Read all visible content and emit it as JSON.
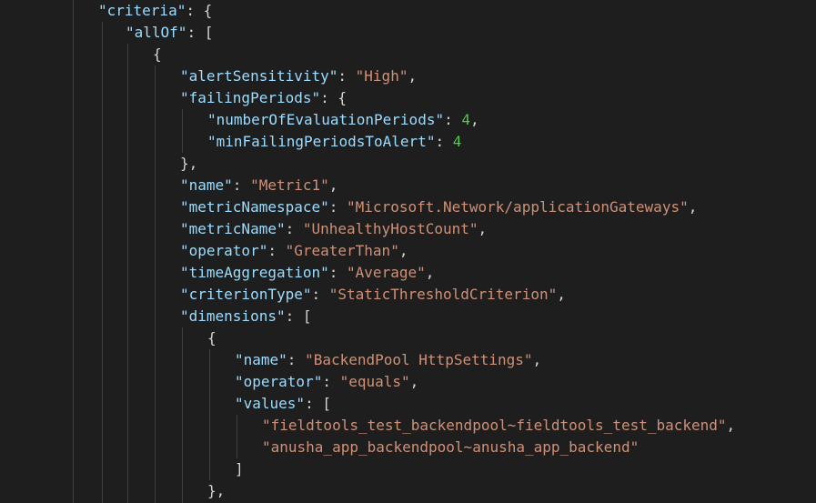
{
  "editor": {
    "colors": {
      "background": "#1e1e1e",
      "key": "#9cdcfe",
      "string": "#ce9178",
      "number": "#4ec94e",
      "punctuation": "#d4d4d4",
      "indent_guide": "#404040"
    },
    "lines": [
      {
        "indent": 0,
        "tokens": [
          {
            "t": "key",
            "v": "\"criteria\""
          },
          {
            "t": "pun",
            "v": ": {"
          }
        ]
      },
      {
        "indent": 1,
        "tokens": [
          {
            "t": "key",
            "v": "\"allOf\""
          },
          {
            "t": "pun",
            "v": ": ["
          }
        ]
      },
      {
        "indent": 2,
        "tokens": [
          {
            "t": "pun",
            "v": "{"
          }
        ]
      },
      {
        "indent": 3,
        "tokens": [
          {
            "t": "key",
            "v": "\"alertSensitivity\""
          },
          {
            "t": "pun",
            "v": ": "
          },
          {
            "t": "str",
            "v": "\"High\""
          },
          {
            "t": "pun",
            "v": ","
          }
        ]
      },
      {
        "indent": 3,
        "tokens": [
          {
            "t": "key",
            "v": "\"failingPeriods\""
          },
          {
            "t": "pun",
            "v": ": {"
          }
        ]
      },
      {
        "indent": 4,
        "tokens": [
          {
            "t": "key",
            "v": "\"numberOfEvaluationPeriods\""
          },
          {
            "t": "pun",
            "v": ": "
          },
          {
            "t": "num",
            "v": "4"
          },
          {
            "t": "pun",
            "v": ","
          }
        ]
      },
      {
        "indent": 4,
        "tokens": [
          {
            "t": "key",
            "v": "\"minFailingPeriodsToAlert\""
          },
          {
            "t": "pun",
            "v": ": "
          },
          {
            "t": "num",
            "v": "4"
          }
        ]
      },
      {
        "indent": 3,
        "tokens": [
          {
            "t": "pun",
            "v": "},"
          }
        ]
      },
      {
        "indent": 3,
        "tokens": [
          {
            "t": "key",
            "v": "\"name\""
          },
          {
            "t": "pun",
            "v": ": "
          },
          {
            "t": "str",
            "v": "\"Metric1\""
          },
          {
            "t": "pun",
            "v": ","
          }
        ]
      },
      {
        "indent": 3,
        "tokens": [
          {
            "t": "key",
            "v": "\"metricNamespace\""
          },
          {
            "t": "pun",
            "v": ": "
          },
          {
            "t": "str",
            "v": "\"Microsoft.Network/applicationGateways\""
          },
          {
            "t": "pun",
            "v": ","
          }
        ]
      },
      {
        "indent": 3,
        "tokens": [
          {
            "t": "key",
            "v": "\"metricName\""
          },
          {
            "t": "pun",
            "v": ": "
          },
          {
            "t": "str",
            "v": "\"UnhealthyHostCount\""
          },
          {
            "t": "pun",
            "v": ","
          }
        ]
      },
      {
        "indent": 3,
        "tokens": [
          {
            "t": "key",
            "v": "\"operator\""
          },
          {
            "t": "pun",
            "v": ": "
          },
          {
            "t": "str",
            "v": "\"GreaterThan\""
          },
          {
            "t": "pun",
            "v": ","
          }
        ]
      },
      {
        "indent": 3,
        "tokens": [
          {
            "t": "key",
            "v": "\"timeAggregation\""
          },
          {
            "t": "pun",
            "v": ": "
          },
          {
            "t": "str",
            "v": "\"Average\""
          },
          {
            "t": "pun",
            "v": ","
          }
        ]
      },
      {
        "indent": 3,
        "tokens": [
          {
            "t": "key",
            "v": "\"criterionType\""
          },
          {
            "t": "pun",
            "v": ": "
          },
          {
            "t": "str",
            "v": "\"StaticThresholdCriterion\""
          },
          {
            "t": "pun",
            "v": ","
          }
        ]
      },
      {
        "indent": 3,
        "tokens": [
          {
            "t": "key",
            "v": "\"dimensions\""
          },
          {
            "t": "pun",
            "v": ": ["
          }
        ]
      },
      {
        "indent": 4,
        "tokens": [
          {
            "t": "pun",
            "v": "{"
          }
        ]
      },
      {
        "indent": 5,
        "tokens": [
          {
            "t": "key",
            "v": "\"name\""
          },
          {
            "t": "pun",
            "v": ": "
          },
          {
            "t": "str",
            "v": "\"BackendPool HttpSettings\""
          },
          {
            "t": "pun",
            "v": ","
          }
        ]
      },
      {
        "indent": 5,
        "tokens": [
          {
            "t": "key",
            "v": "\"operator\""
          },
          {
            "t": "pun",
            "v": ": "
          },
          {
            "t": "str",
            "v": "\"equals\""
          },
          {
            "t": "pun",
            "v": ","
          }
        ]
      },
      {
        "indent": 5,
        "tokens": [
          {
            "t": "key",
            "v": "\"values\""
          },
          {
            "t": "pun",
            "v": ": ["
          }
        ]
      },
      {
        "indent": 6,
        "tokens": [
          {
            "t": "str",
            "v": "\"fieldtools_test_backendpool~fieldtools_test_backend\""
          },
          {
            "t": "pun",
            "v": ","
          }
        ]
      },
      {
        "indent": 6,
        "tokens": [
          {
            "t": "str",
            "v": "\"anusha_app_backendpool~anusha_app_backend\""
          }
        ]
      },
      {
        "indent": 5,
        "tokens": [
          {
            "t": "pun",
            "v": "]"
          }
        ]
      },
      {
        "indent": 4,
        "tokens": [
          {
            "t": "pun",
            "v": "},"
          }
        ]
      }
    ]
  }
}
